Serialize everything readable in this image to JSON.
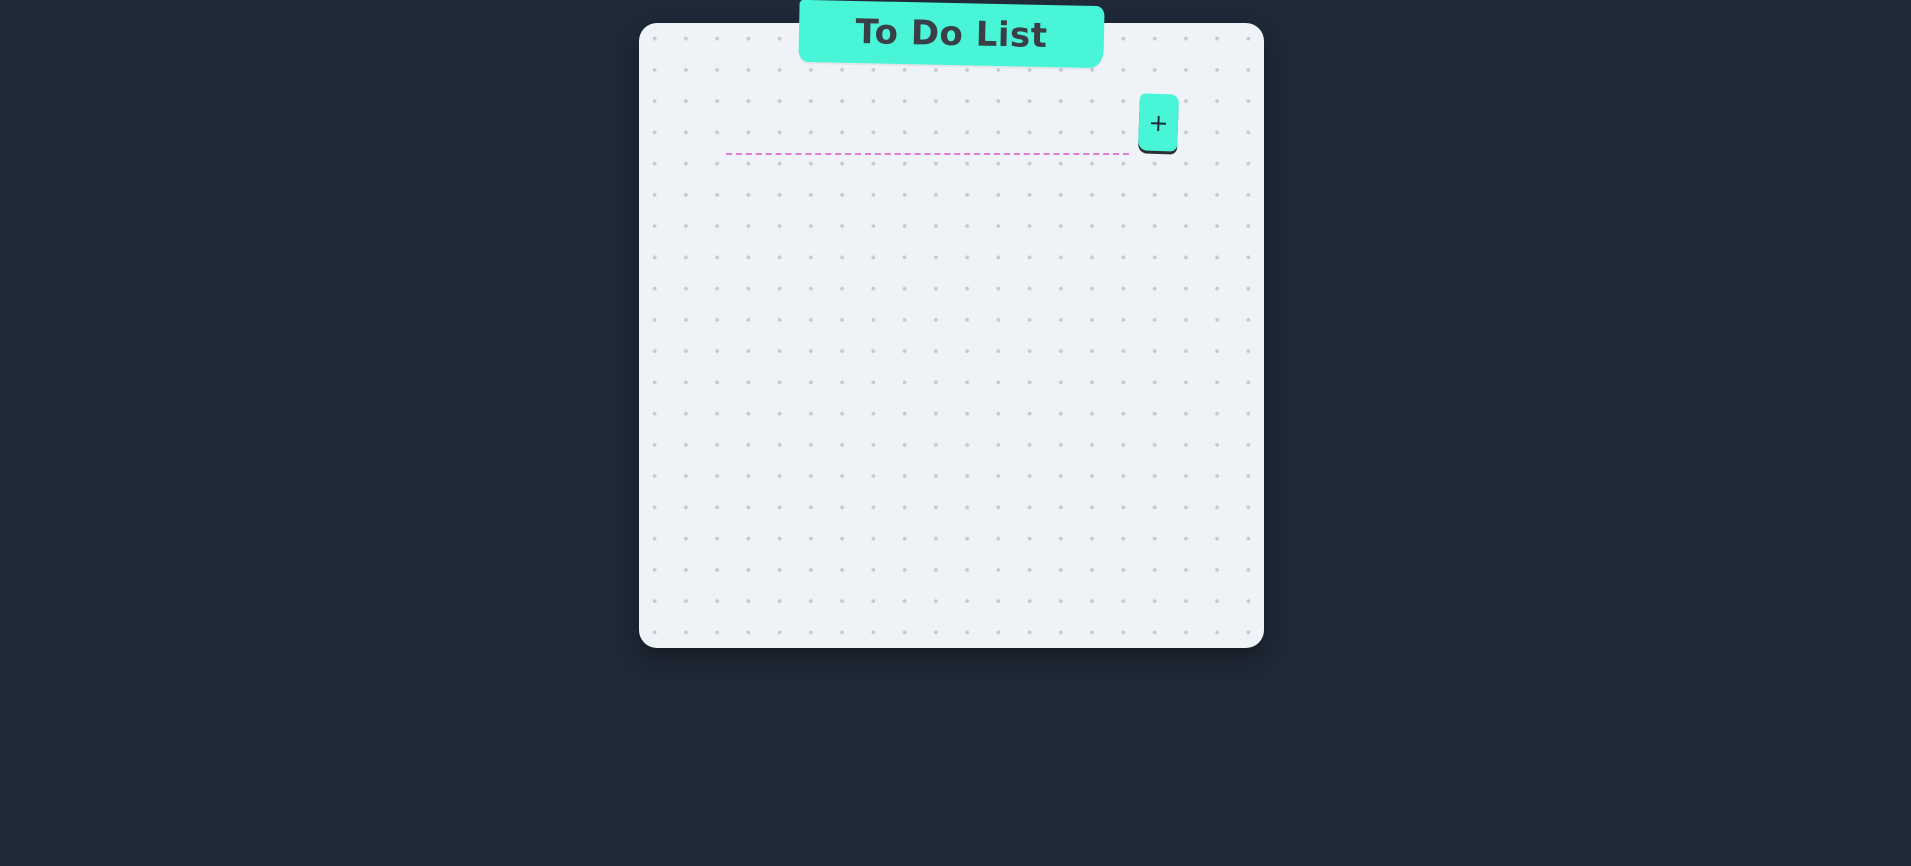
{
  "app": {
    "title": "To Do List"
  },
  "new_task": {
    "value": "",
    "placeholder": ""
  },
  "add_button": {
    "icon": "plus-icon",
    "label": "+"
  },
  "colors": {
    "background": "#1f2937",
    "board": "#eff3f7",
    "accent": "#48f5d6",
    "input_underline": "#e07bd6",
    "text": "#3a3f47"
  }
}
